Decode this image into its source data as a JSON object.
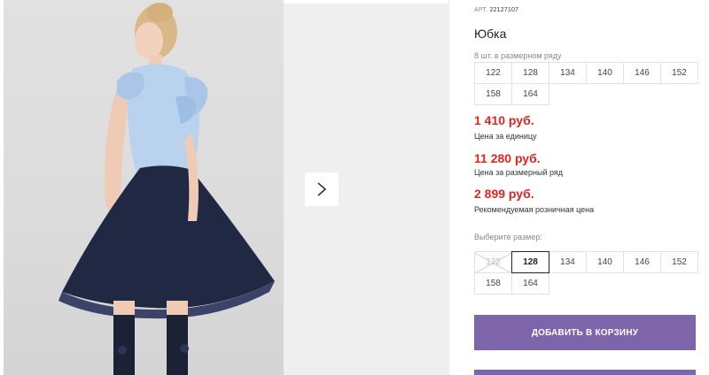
{
  "product": {
    "sku_prefix": "АРТ.",
    "sku": "22127107",
    "title": "Юбка"
  },
  "range": {
    "label": "8 шт. в размерном ряду",
    "sizes": [
      "122",
      "128",
      "134",
      "140",
      "146",
      "152",
      "158",
      "164"
    ]
  },
  "prices": [
    {
      "value": "1 410 руб.",
      "note": "Цена за единицу"
    },
    {
      "value": "11 280 руб.",
      "note": "Цена за размерный ряд"
    },
    {
      "value": "2 899 руб.",
      "note": "Рекомендуемая розничная цена"
    }
  ],
  "size_select": {
    "label": "Выберите размер:",
    "options": [
      {
        "label": "122",
        "state": "unavailable"
      },
      {
        "label": "128",
        "state": "selected"
      },
      {
        "label": "134",
        "state": "available"
      },
      {
        "label": "140",
        "state": "available"
      },
      {
        "label": "146",
        "state": "available"
      },
      {
        "label": "152",
        "state": "available"
      },
      {
        "label": "158",
        "state": "available"
      },
      {
        "label": "164",
        "state": "available"
      }
    ]
  },
  "actions": {
    "add_to_cart": "Добавить в корзину"
  },
  "icons": {
    "next": "chevron-right-icon"
  },
  "colors": {
    "accent": "#7e64a8",
    "price": "#e2251f"
  }
}
